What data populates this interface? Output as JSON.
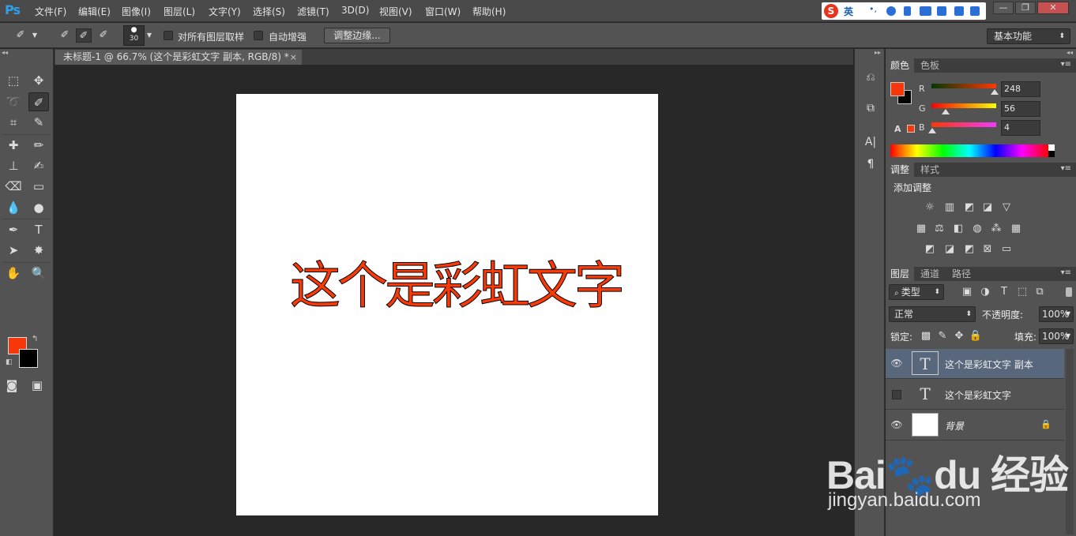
{
  "app": {
    "logo": "Ps",
    "brand_color": "#2ea0ea"
  },
  "menu": [
    "文件(F)",
    "编辑(E)",
    "图像(I)",
    "图层(L)",
    "文字(Y)",
    "选择(S)",
    "滤镜(T)",
    "3D(D)",
    "视图(V)",
    "窗口(W)",
    "帮助(H)"
  ],
  "ime": {
    "logo": "S",
    "label": "英"
  },
  "window_controls": {
    "minimize": "—",
    "restore": "❐",
    "close": "✕"
  },
  "options": {
    "brush_size": "30",
    "sample_all_layers": "对所有图层取样",
    "auto_enhance": "自动增强",
    "refine_edge": "调整边缘...",
    "workspace": "基本功能"
  },
  "document": {
    "tab_title": "未标题-1 @ 66.7% (这个是彩虹文字 副本, RGB/8) *",
    "close": "×",
    "text": "这个是彩虹文字",
    "text_color": "#f83a08"
  },
  "colors": {
    "foreground": "#f8380a",
    "background": "#000000"
  },
  "color_panel": {
    "tabs": [
      "颜色",
      "色板"
    ],
    "r": {
      "label": "R",
      "value": "248",
      "fraction": 0.973
    },
    "g": {
      "label": "G",
      "value": "56",
      "fraction": 0.22
    },
    "b": {
      "label": "B",
      "value": "4",
      "fraction": 0.016
    }
  },
  "adjust_panel": {
    "tabs": [
      "调整",
      "样式"
    ],
    "title": "添加调整"
  },
  "layers_panel": {
    "tabs": [
      "图层",
      "通道",
      "路径"
    ],
    "filter_kind": "类型",
    "blend_mode": "正常",
    "opacity_label": "不透明度:",
    "opacity": "100%",
    "lock_label": "锁定:",
    "fill_label": "填充:",
    "fill": "100%",
    "layers": [
      {
        "name": "这个是彩虹文字 副本",
        "type": "T",
        "visible": true,
        "active": true
      },
      {
        "name": "这个是彩虹文字",
        "type": "T",
        "visible": false,
        "active": false
      },
      {
        "name": "背景",
        "type": "image",
        "visible": true,
        "active": false,
        "locked": true
      }
    ]
  },
  "watermark": {
    "main": "Bai🐾du 经验",
    "url": "jingyan.baidu.com"
  }
}
